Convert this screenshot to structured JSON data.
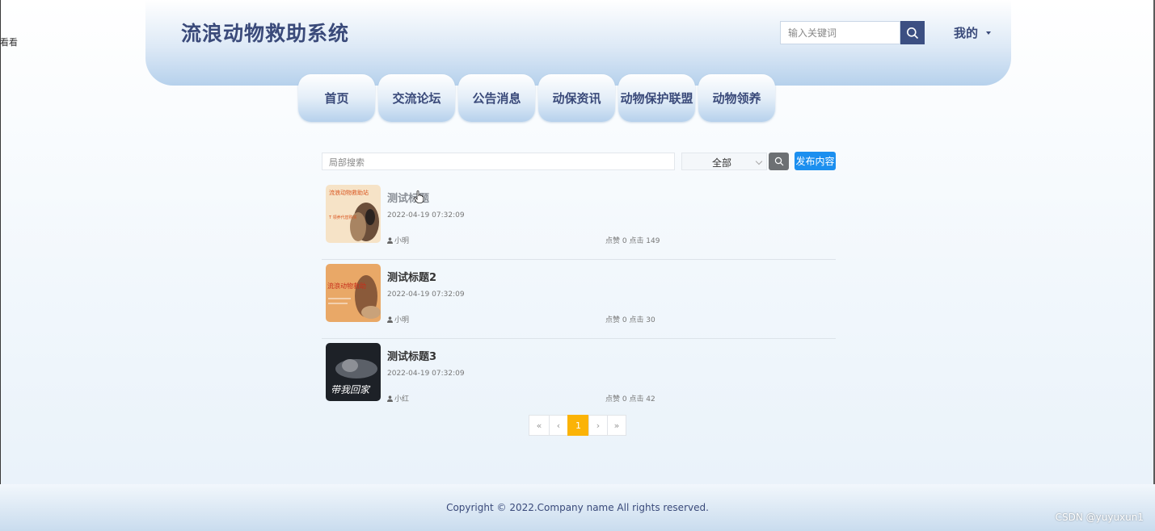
{
  "stray_text": "看看",
  "header": {
    "title": "流浪动物救助系统",
    "search_placeholder": "输入关键词",
    "user_menu": "我的"
  },
  "nav": {
    "items": [
      {
        "label": "首页"
      },
      {
        "label": "交流论坛"
      },
      {
        "label": "公告消息"
      },
      {
        "label": "动保资讯"
      },
      {
        "label": "动物保护联盟"
      },
      {
        "label": "动物领养"
      }
    ]
  },
  "toolbar": {
    "local_search_placeholder": "局部搜索",
    "category_selected": "全部",
    "publish_label": "发布内容"
  },
  "posts": [
    {
      "title": "测试标题",
      "date": "2022-04-19 07:32:09",
      "author": "小明",
      "stats": "点赞 0 点击 149",
      "thumb_text_1": "流浪动物救助站",
      "thumb_text_2": "T 领养代替购买"
    },
    {
      "title": "测试标题2",
      "date": "2022-04-19 07:32:09",
      "author": "小明",
      "stats": "点赞 0 点击 30",
      "thumb_text_1": "流浪动物救助"
    },
    {
      "title": "测试标题3",
      "date": "2022-04-19 07:32:09",
      "author": "小红",
      "stats": "点赞 0 点击 42",
      "thumb_text_1": "带我回家"
    }
  ],
  "pagination": {
    "first": "«",
    "prev": "‹",
    "current": "1",
    "next": "›",
    "last": "»"
  },
  "footer": {
    "copyright": "Copyright © 2022.Company name All rights reserved.",
    "watermark": "CSDN @yuyuxun1"
  },
  "colors": {
    "brand_text": "#3a4a7a",
    "search_button": "#3c4f82",
    "publish_button": "#1c8fef",
    "active_page": "#fbb306"
  }
}
